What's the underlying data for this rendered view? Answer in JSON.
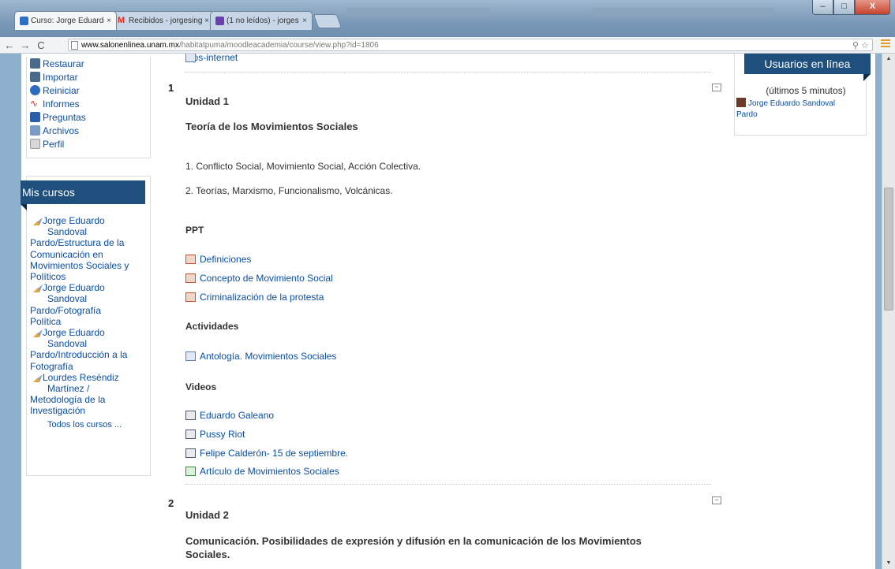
{
  "browser": {
    "tabs": [
      {
        "title": "Curso: Jorge Eduardo",
        "close": "×",
        "favicon_color": "#2a6fc9"
      },
      {
        "title": "Recibidos - jorgesing",
        "close": "×",
        "favicon_color": "#d93025"
      },
      {
        "title": "(1 no leídos) - jorges",
        "close": "×",
        "favicon_color": "#6a3fb0"
      }
    ],
    "address": {
      "host": "www.salonenlinea.unam.mx",
      "path": "/habitatpuma/moodleacademia/course/view.php?id=1806"
    },
    "window_buttons": {
      "minimize": "–",
      "maximize": "□",
      "close": "X"
    }
  },
  "admin_menu": {
    "items": [
      {
        "label": "Restaurar",
        "icon": "restore-icon"
      },
      {
        "label": "Importar",
        "icon": "import-icon"
      },
      {
        "label": "Reiniciar",
        "icon": "reset-icon"
      },
      {
        "label": "Informes",
        "icon": "reports-icon"
      },
      {
        "label": "Preguntas",
        "icon": "questions-icon"
      },
      {
        "label": "Archivos",
        "icon": "files-icon"
      },
      {
        "label": "Perfil",
        "icon": "profile-icon"
      }
    ]
  },
  "mis_cursos": {
    "title": "Mis cursos",
    "courses": [
      {
        "line1": "Jorge Eduardo",
        "line2": "Sandoval",
        "rest": [
          "Pardo/Estructura de la",
          "Comunicación en",
          "Movimientos Sociales y",
          "Políticos"
        ]
      },
      {
        "line1": "Jorge Eduardo",
        "line2": "Sandoval",
        "rest": [
          "Pardo/Fotografía",
          "Política"
        ]
      },
      {
        "line1": "Jorge Eduardo",
        "line2": "Sandoval",
        "rest": [
          "Pardo/Introducción a la",
          "Fotografía"
        ]
      },
      {
        "line1": "Lourdes Reséndiz",
        "line2": "Martínez /",
        "rest": [
          "Metodología de la",
          "Investigación"
        ]
      }
    ],
    "all_courses": "Todos los cursos ..."
  },
  "main": {
    "top_link": "Tips-internet",
    "section1": {
      "number": "1",
      "title": "Unidad 1",
      "subtitle": "Teoría de los Movimientos Sociales",
      "lines": [
        "1. Conflicto Social, Movimiento Social, Acción Colectiva.",
        "2. Teorías, Marxismo, Funcionalismo, Volcánicas."
      ],
      "ppt_heading": "PPT",
      "ppt": [
        "Definiciones",
        "Concepto de Movimiento Social",
        "Criminalización de la protesta"
      ],
      "actividades_heading": "Actividades",
      "actividades": [
        "Antología. Movimientos Sociales"
      ],
      "videos_heading": "Videos",
      "videos": [
        "Eduardo Galeano",
        "Pussy Riot",
        "Felipe Calderón- 15 de septiembre.",
        "Artículo de Movimientos Sociales"
      ]
    },
    "section2": {
      "number": "2",
      "title": "Unidad 2",
      "subtitle_line1": "Comunicación. Posibilidades de expresión y difusión en la comunicación de los Movimientos",
      "subtitle_line2": "Sociales."
    },
    "collapse_symbol": "−"
  },
  "online_users": {
    "title": "Usuarios en línea",
    "subtitle": "(últimos 5 minutos)",
    "user_line1": "Jorge Eduardo Sandoval",
    "user_line2": "Pardo"
  },
  "colors": {
    "block_header": "#1f4f7d",
    "link": "#0b4ea2",
    "page_bg": "#8eb0cc"
  }
}
